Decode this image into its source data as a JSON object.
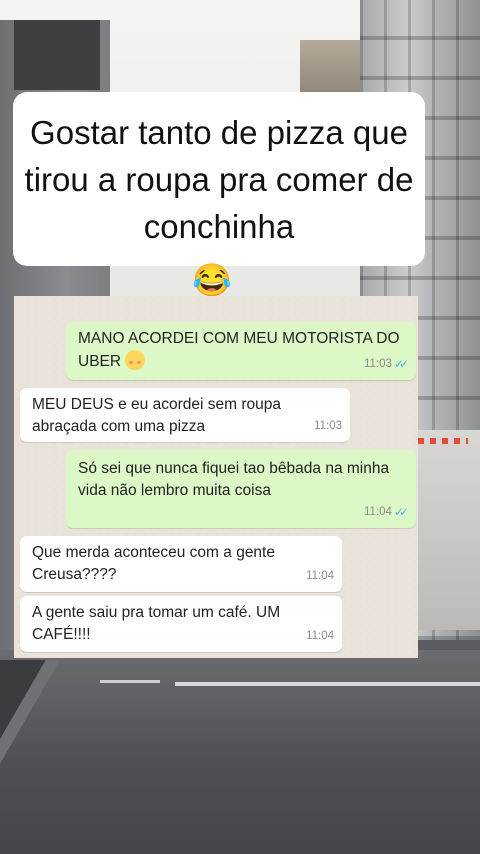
{
  "caption": {
    "text": "Gostar tanto de pizza que tirou a roupa pra comer de conchinha",
    "emoji": "😂",
    "emoji_name": "face-with-tears-of-joy-icon"
  },
  "chat": {
    "messages": [
      {
        "direction": "outgoing",
        "text": "MANO ACORDEI COM MEU MOTORISTA DO UBER",
        "emoji": "flushed-face-icon",
        "time": "11:03",
        "read": true
      },
      {
        "direction": "incoming",
        "text": "MEU DEUS e eu acordei sem roupa abraçada com uma pizza",
        "time": "11:03"
      },
      {
        "direction": "outgoing",
        "text": "Só sei que nunca fiquei tao bêbada na minha vida não lembro muita coisa",
        "time": "11:04",
        "read": true
      },
      {
        "direction": "incoming",
        "text": "Que merda aconteceu com a gente Creusa????",
        "time": "11:04"
      },
      {
        "direction": "incoming",
        "text": "A gente saiu pra tomar um café. UM CAFÉ!!!!",
        "time": "11:04"
      }
    ],
    "colors": {
      "outgoing_bubble": "#dcf8c6",
      "incoming_bubble": "#ffffff",
      "wallpaper": "#e9e3da",
      "read_ticks": "#4fb6ec"
    }
  }
}
